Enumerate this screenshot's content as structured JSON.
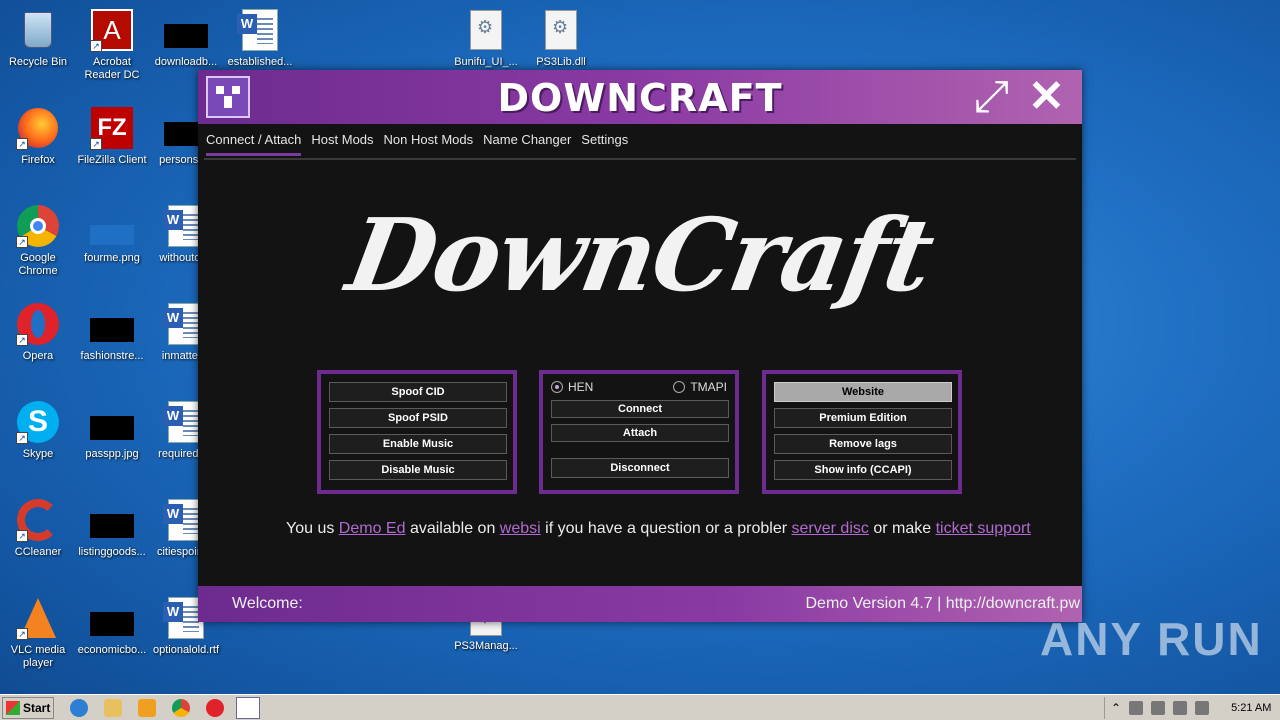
{
  "desktop": {
    "icons": [
      {
        "label": "Recycle Bin",
        "icon": "recycle-bin-icon"
      },
      {
        "label": "Acrobat Reader DC",
        "icon": "acrobat-icon"
      },
      {
        "label": "downloadb...",
        "icon": "file-icon"
      },
      {
        "label": "established...",
        "icon": "word-doc-icon"
      },
      {
        "label": "Bunifu_UI_...",
        "icon": "gear-file-icon"
      },
      {
        "label": "PS3Lib.dll",
        "icon": "gear-file-icon"
      },
      {
        "label": "Firefox",
        "icon": "firefox-icon"
      },
      {
        "label": "FileZilla Client",
        "icon": "filezilla-icon"
      },
      {
        "label": "personsc...",
        "icon": "file-icon"
      },
      {
        "label": "Google Chrome",
        "icon": "chrome-icon"
      },
      {
        "label": "fourme.png",
        "icon": "image-icon"
      },
      {
        "label": "withoutor...",
        "icon": "word-doc-icon"
      },
      {
        "label": "Opera",
        "icon": "opera-icon"
      },
      {
        "label": "fashionstre...",
        "icon": "file-icon"
      },
      {
        "label": "inmatter...",
        "icon": "word-doc-icon"
      },
      {
        "label": "Skype",
        "icon": "skype-icon"
      },
      {
        "label": "passpp.jpg",
        "icon": "image-icon"
      },
      {
        "label": "requiredn...",
        "icon": "word-doc-icon"
      },
      {
        "label": "CCleaner",
        "icon": "ccleaner-icon"
      },
      {
        "label": "listinggoods...",
        "icon": "file-icon"
      },
      {
        "label": "citiespoint...",
        "icon": "word-doc-icon"
      },
      {
        "label": "VLC media player",
        "icon": "vlc-icon"
      },
      {
        "label": "economicbo...",
        "icon": "file-icon"
      },
      {
        "label": "optionalold.rtf",
        "icon": "word-doc-icon"
      },
      {
        "label": "PS3Manag...",
        "icon": "gear-file-icon"
      }
    ]
  },
  "app": {
    "title": "DOWNCRAFT",
    "tabs": [
      "Connect / Attach",
      "Host Mods",
      "Non Host Mods",
      "Name Changer",
      "Settings"
    ],
    "active_tab": "Connect / Attach",
    "brand": "DownCraft",
    "panel_left": {
      "buttons": [
        "Spoof CID",
        "Spoof PSID",
        "Enable Music",
        "Disable Music"
      ]
    },
    "panel_center": {
      "radio_hen": "HEN",
      "radio_tmapi": "TMAPI",
      "selected": "HEN",
      "connect": "Connect",
      "attach": "Attach",
      "disconnect": "Disconnect"
    },
    "panel_right": {
      "buttons": [
        "Website",
        "Premium Edition",
        "Remove lags",
        "Show info (CCAPI)"
      ]
    },
    "info": {
      "t1": "You us ",
      "l1": "Demo Ed",
      "t2": " available on ",
      "l2": "websi",
      "t3": " if you have a question or a probler ",
      "l3": "server disc",
      "t4": " or make ",
      "l4": "ticket support"
    },
    "status_left": "Welcome:",
    "status_right": "Demo Version 4.7 | http://downcraft.pw"
  },
  "watermark": "ANY RUN",
  "taskbar": {
    "start": "Start",
    "clock": "5:21 AM"
  },
  "colors": {
    "accent": "#6d2b8f",
    "link": "#b06ad0",
    "background": "#141314"
  }
}
